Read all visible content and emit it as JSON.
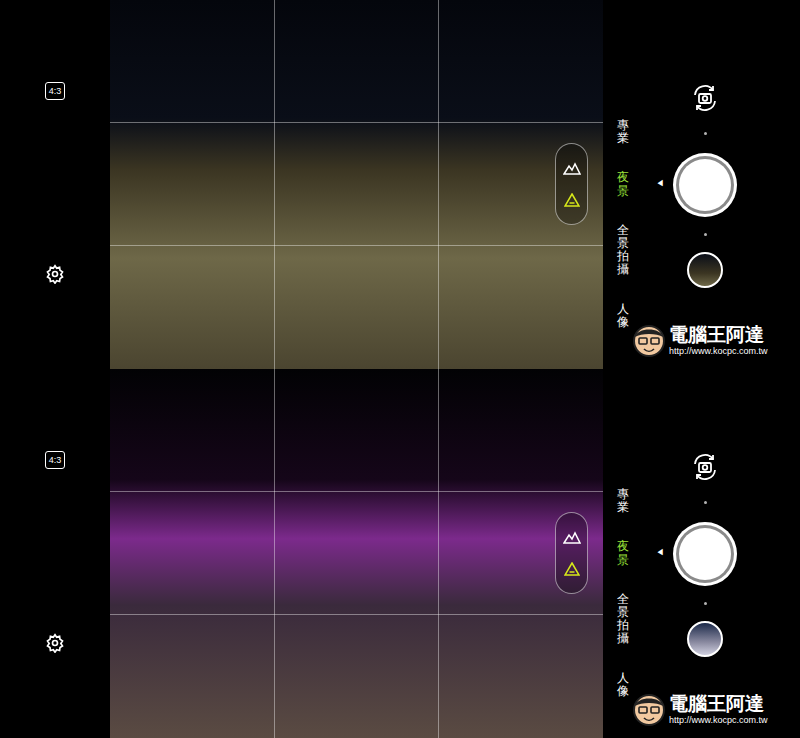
{
  "panels": [
    {
      "aspect_ratio": "4:3",
      "modes": [
        {
          "label": "專業",
          "selected": false
        },
        {
          "label": "夜景",
          "selected": true
        },
        {
          "label": "全景拍攝",
          "selected": false
        },
        {
          "label": "人像",
          "selected": false
        }
      ],
      "mode_pointer": "◀",
      "watermark": {
        "name": "電腦王阿達",
        "url": "http://www.kocpc.com.tw"
      }
    },
    {
      "aspect_ratio": "4:3",
      "modes": [
        {
          "label": "專業",
          "selected": false
        },
        {
          "label": "夜景",
          "selected": true
        },
        {
          "label": "全景拍攝",
          "selected": false
        },
        {
          "label": "人像",
          "selected": false
        }
      ],
      "mode_pointer": "◀",
      "watermark": {
        "name": "電腦王阿達",
        "url": "http://www.kocpc.com.tw"
      }
    }
  ]
}
